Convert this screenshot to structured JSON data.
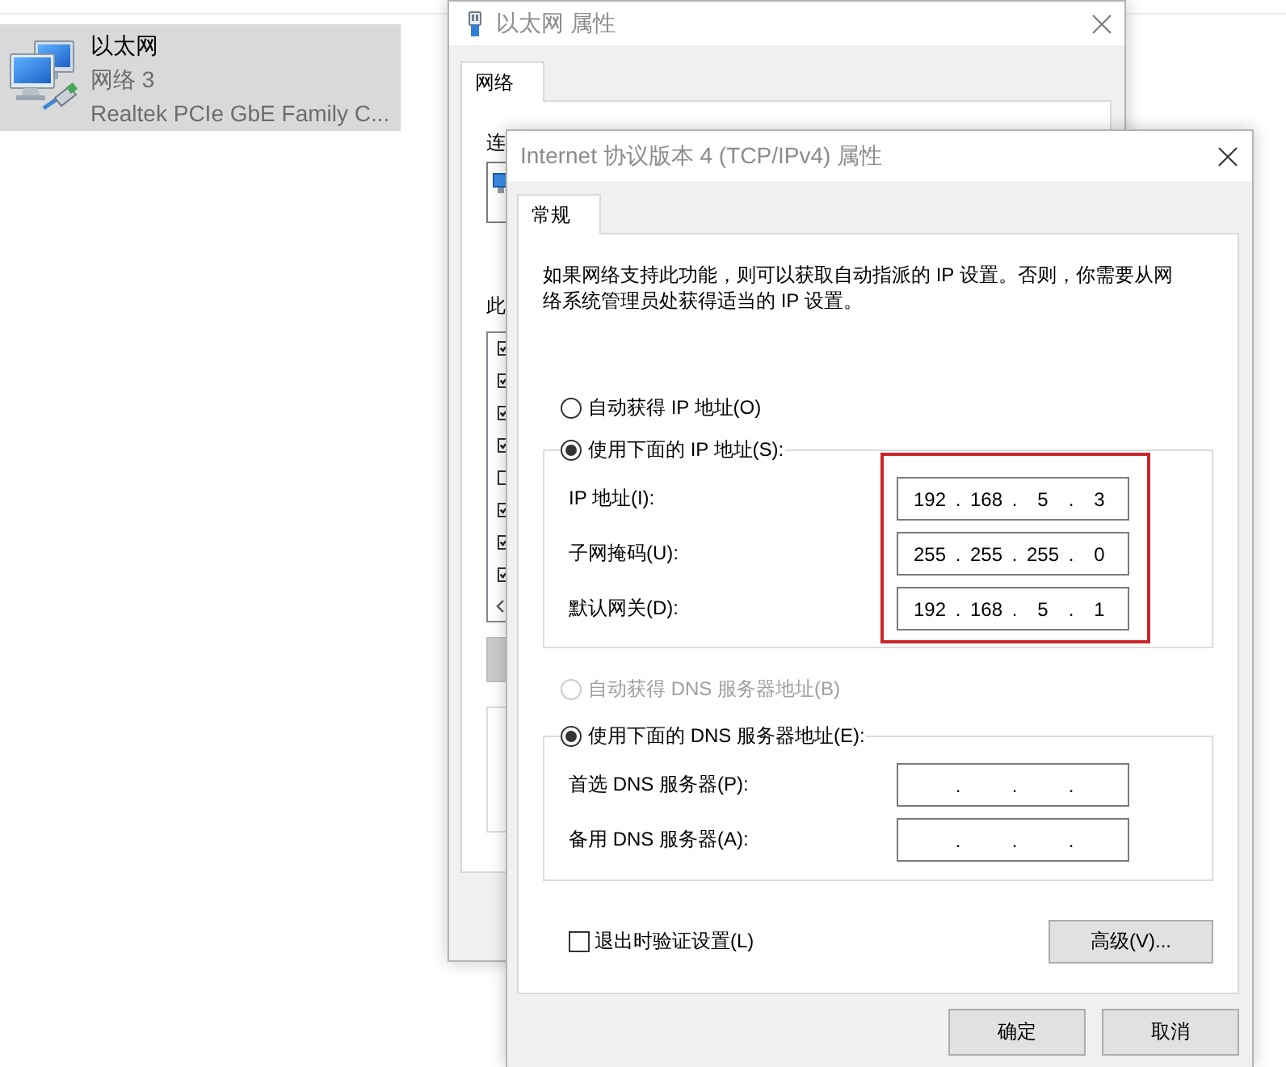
{
  "explorer_item": {
    "name": "以太网",
    "network": "网络 3",
    "device": "Realtek PCIe GbE Family C...",
    "selected": true
  },
  "back_dialog": {
    "title": "以太网 属性",
    "tabs": [
      {
        "label": "网络",
        "selected": true
      }
    ],
    "field_label": "连",
    "list_label": "此",
    "components": [
      {
        "checked": true
      },
      {
        "checked": true
      },
      {
        "checked": true
      },
      {
        "checked": true
      },
      {
        "checked": false
      },
      {
        "checked": true
      },
      {
        "checked": true
      },
      {
        "checked": true
      }
    ]
  },
  "front_dialog": {
    "title": "Internet 协议版本 4 (TCP/IPv4) 属性",
    "tabs": [
      {
        "label": "常规",
        "selected": true
      }
    ],
    "description": "如果网络支持此功能，则可以获取自动指派的 IP 设置。否则，你需要从网络系统管理员处获得适当的 IP 设置。",
    "ip_options": [
      {
        "label": "自动获得 IP 地址(O)",
        "selected": false,
        "disabled": false
      },
      {
        "label": "使用下面的 IP 地址(S):",
        "selected": true,
        "disabled": false
      }
    ],
    "ip_fields": {
      "highlighted": true,
      "rows": [
        {
          "label": "IP 地址(I):",
          "octets": [
            "192",
            "168",
            "5",
            "3"
          ],
          "dots": [
            ".",
            ".",
            "."
          ]
        },
        {
          "label": "子网掩码(U):",
          "octets": [
            "255",
            "255",
            "255",
            "0"
          ],
          "dots": [
            ".",
            ".",
            "."
          ]
        },
        {
          "label": "默认网关(D):",
          "octets": [
            "192",
            "168",
            "5",
            "1"
          ],
          "dots": [
            ".",
            ".",
            "."
          ]
        }
      ]
    },
    "dns_options": [
      {
        "label": "自动获得 DNS 服务器地址(B)",
        "selected": false,
        "disabled": true
      },
      {
        "label": "使用下面的 DNS 服务器地址(E):",
        "selected": true,
        "disabled": false
      }
    ],
    "dns_fields": {
      "rows": [
        {
          "label": "首选 DNS 服务器(P):",
          "dots": [
            ".",
            ".",
            "."
          ]
        },
        {
          "label": "备用 DNS 服务器(A):",
          "dots": [
            ".",
            ".",
            "."
          ]
        }
      ]
    },
    "verify_on_exit": {
      "label": "退出时验证设置(L)",
      "checked": false
    },
    "advanced_button": "高级(V)...",
    "buttons": [
      "确定",
      "取消"
    ]
  }
}
